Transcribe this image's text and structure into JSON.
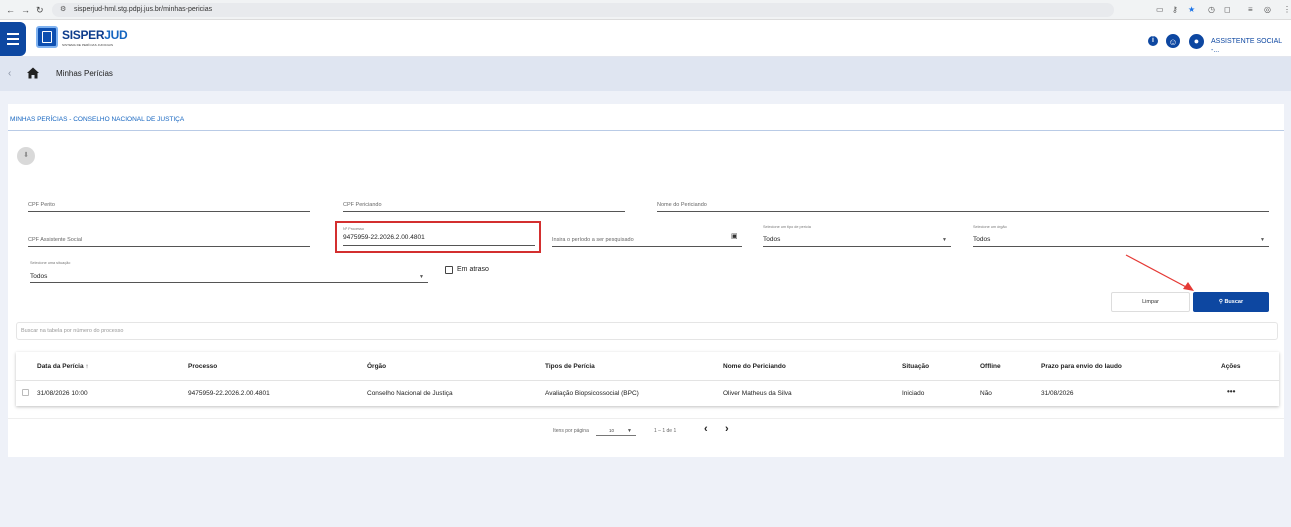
{
  "browser": {
    "url": "sisperjud-hml.stg.pdpj.jus.br/minhas-pericias"
  },
  "header": {
    "logo_title_a": "SISPER",
    "logo_title_b": "JUD",
    "logo_subtitle": "SISTEMA DE PERÍCIAS JUDICIAIS",
    "user_label": "ASSISTENTE SOCIAL -..."
  },
  "breadcrumb": {
    "page": "Minhas Perícias"
  },
  "card": {
    "title": "MINHAS PERÍCIAS - CONSELHO NACIONAL DE JUSTIÇA"
  },
  "filters": {
    "cpf_perito": "CPF Perito",
    "cpf_periciando": "CPF Periciando",
    "nome_periciando": "Nome do Periciando",
    "cpf_assistente": "CPF Assistente Social",
    "processo_label": "Nº Processo",
    "processo_value": "9475959-22.2026.2.00.4801",
    "periodo": "Insira o período a ser pesquisado",
    "tipo_label": "Selecione um tipo de perícia",
    "tipo_value": "Todos",
    "orgao_label": "Selecione um órgão",
    "orgao_value": "Todos",
    "situacao_label": "Selecione uma situação",
    "situacao_value": "Todos",
    "em_atraso": "Em atraso"
  },
  "buttons": {
    "limpar": "Limpar",
    "buscar": "Buscar"
  },
  "table_search": {
    "placeholder": "Buscar na tabela por número do processo"
  },
  "table": {
    "columns": [
      "Data da Perícia ↑",
      "Processo",
      "Órgão",
      "Tipos de Perícia",
      "Nome do Periciando",
      "Situação",
      "Offline",
      "Prazo para envio do laudo",
      "Ações"
    ],
    "rows": [
      [
        "31/08/2026 10:00",
        "9475959-22.2026.2.00.4801",
        "Conselho Nacional de Justiça",
        "Avaliação Biopsicossocial (BPC)",
        "Oliver Matheus da Silva",
        "Iniciado",
        "Não",
        "31/08/2026",
        "•••"
      ]
    ]
  },
  "paginator": {
    "label": "Itens por página",
    "page_size": "10",
    "range": "1 – 1 de 1"
  }
}
